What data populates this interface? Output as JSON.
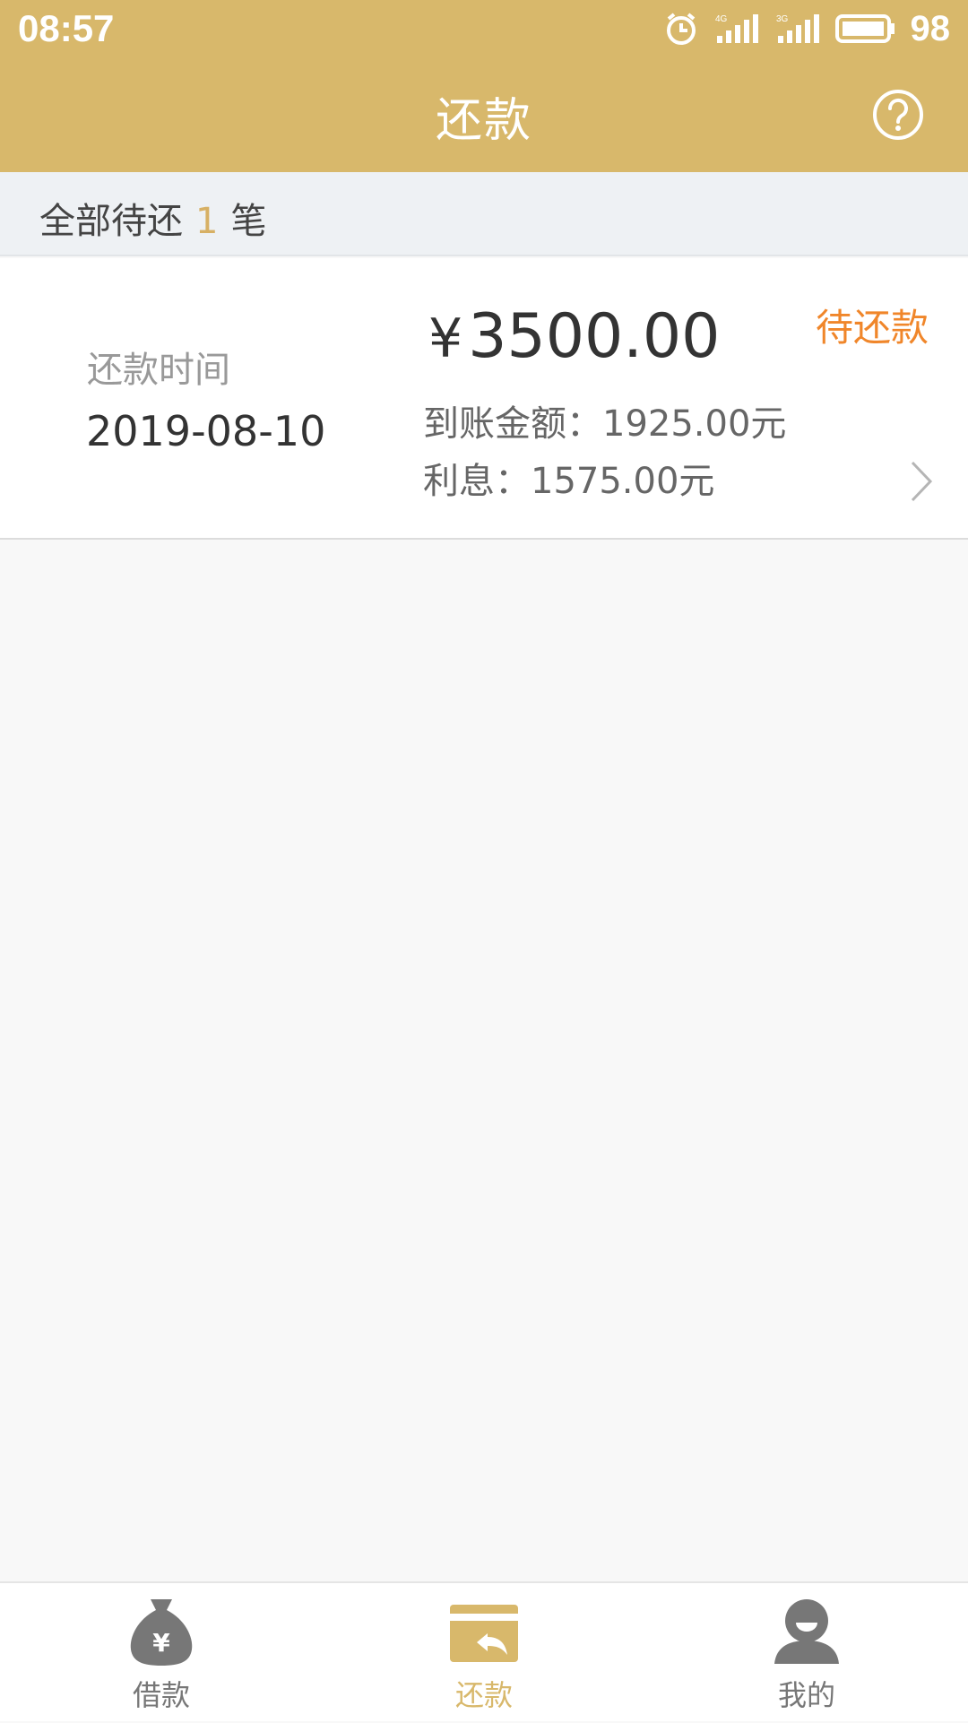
{
  "status_bar": {
    "time": "08:57",
    "network_1": "4G",
    "network_2": "3G",
    "battery": "98"
  },
  "header": {
    "title": "还款"
  },
  "summary": {
    "prefix": "全部待还",
    "count": "1",
    "suffix": "笔"
  },
  "loan": {
    "due_label": "还款时间",
    "due_date": "2019-08-10",
    "currency_symbol": "¥",
    "amount": "3500.00",
    "status": "待还款",
    "received": "到账金额：1925.00元",
    "interest": "利息：1575.00元"
  },
  "tabs": [
    {
      "label": "借款",
      "icon": "money-bag-icon"
    },
    {
      "label": "还款",
      "icon": "repay-card-icon",
      "active": true
    },
    {
      "label": "我的",
      "icon": "user-icon"
    }
  ],
  "colors": {
    "header": "#d8b86b",
    "status_orange": "#f0862a",
    "summary_count": "#d7b064"
  }
}
